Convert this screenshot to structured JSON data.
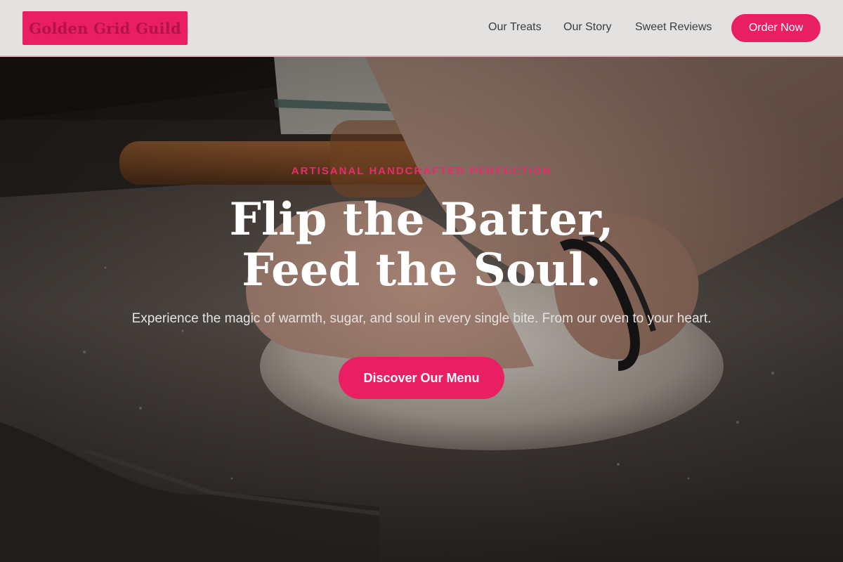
{
  "header": {
    "logo_text": "Golden Grid Guild",
    "nav": [
      {
        "label": "Our Treats"
      },
      {
        "label": "Our Story"
      },
      {
        "label": "Sweet Reviews"
      }
    ],
    "cta_label": "Order Now"
  },
  "hero": {
    "eyebrow": "ARTISANAL HANDCRAFTED PERFECTION",
    "headline_line1": "Flip the Batter,",
    "headline_line2": "Feed the Soul.",
    "subtitle": "Experience the magic of warmth, sugar, and soul in every single bite. From our oven to your heart.",
    "cta_label": "Discover Our Menu",
    "background_image": "hands kneading dough on a floured surface with a rolling pin"
  },
  "colors": {
    "accent": "#e91e63",
    "header_bg": "#e4e2e1",
    "logo_text": "#b3124a",
    "nav_text": "#3a3a44",
    "eyebrow": "#ea2a6e",
    "headline": "#ffffff",
    "subtitle": "#e6e3e0"
  }
}
